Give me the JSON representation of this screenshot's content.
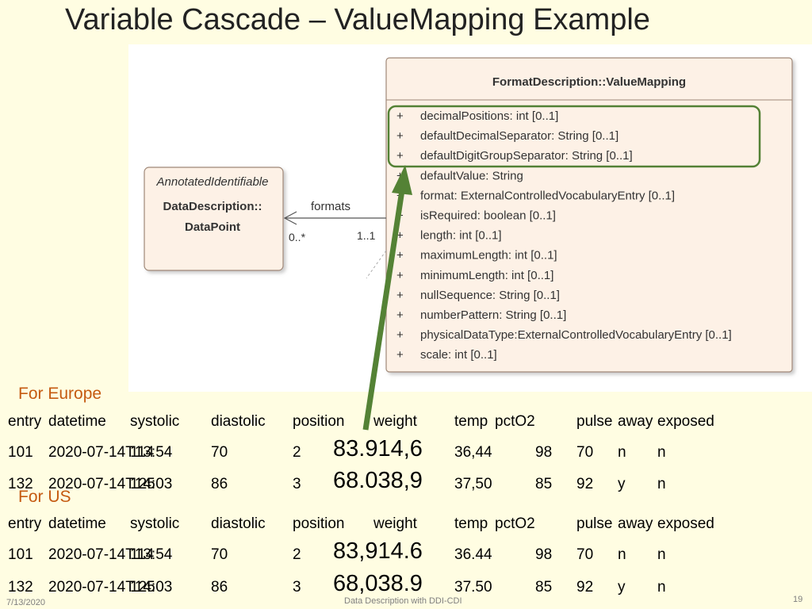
{
  "slide": {
    "title": "Variable Cascade – ValueMapping Example",
    "footer_date": "7/13/2020",
    "footer_center": "Data Description with DDI-CDI",
    "page_number": "19"
  },
  "diagram": {
    "class_box": {
      "title": "FormatDescription::ValueMapping",
      "attributes": [
        {
          "vis": "+",
          "text": "decimalPositions: int [0..1]"
        },
        {
          "vis": "+",
          "text": "defaultDecimalSeparator: String [0..1]"
        },
        {
          "vis": "+",
          "text": "defaultDigitGroupSeparator: String [0..1]"
        },
        {
          "vis": "+",
          "text": "defaultValue: String"
        },
        {
          "vis": "+",
          "text": "format: ExternalControlledVocabularyEntry [0..1]"
        },
        {
          "vis": "+",
          "text": "isRequired: boolean [0..1]"
        },
        {
          "vis": "+",
          "text": "length: int [0..1]"
        },
        {
          "vis": "+",
          "text": "maximumLength: int [0..1]"
        },
        {
          "vis": "+",
          "text": "minimumLength: int [0..1]"
        },
        {
          "vis": "+",
          "text": "nullSequence: String [0..1]"
        },
        {
          "vis": "+",
          "text": "numberPattern: String [0..1]"
        },
        {
          "vis": "+",
          "text": "physicalDataType:ExternalControlledVocabularyEntry [0..1]"
        },
        {
          "vis": "+",
          "text": "scale: int [0..1]"
        }
      ]
    },
    "left_box": {
      "stereotype": "AnnotatedIdentifiable",
      "name_line1": "DataDescription::",
      "name_line2": "DataPoint"
    },
    "association": {
      "role": "formats",
      "mult_target": "0..*",
      "mult_source": "1..1"
    },
    "colors": {
      "highlight": "#538135",
      "arrow": "#548235",
      "box_fill": "#fdf1e6",
      "box_border": "#a08878"
    }
  },
  "sections": {
    "europe": {
      "label": "For Europe",
      "headers": [
        "entry",
        "datetime",
        "systolic",
        "diastolic",
        "position",
        "weight",
        "temp",
        "pctO2",
        "pulse",
        "away",
        "exposed"
      ],
      "rows": [
        [
          "101",
          "2020-07-14T13:54",
          "114",
          "70",
          "2",
          "83.914,6",
          "36,44",
          "98",
          "70",
          "n",
          "n"
        ],
        [
          "132",
          "2020-07-14T14:03",
          "125",
          "86",
          "3",
          "68.038,9",
          "37,50",
          "85",
          "92",
          "y",
          "n"
        ]
      ]
    },
    "us": {
      "label": "For US",
      "headers": [
        "entry",
        "datetime",
        "systolic",
        "diastolic",
        "position",
        "weight",
        "temp",
        "pctO2",
        "pulse",
        "away",
        "exposed"
      ],
      "rows": [
        [
          "101",
          "2020-07-14T13:54",
          "114",
          "70",
          "2",
          "83,914.6",
          "36.44",
          "98",
          "70",
          "n",
          "n"
        ],
        [
          "132",
          "2020-07-14T14:03",
          "125",
          "86",
          "3",
          "68,038.9",
          "37.50",
          "85",
          "92",
          "y",
          "n"
        ]
      ]
    }
  }
}
